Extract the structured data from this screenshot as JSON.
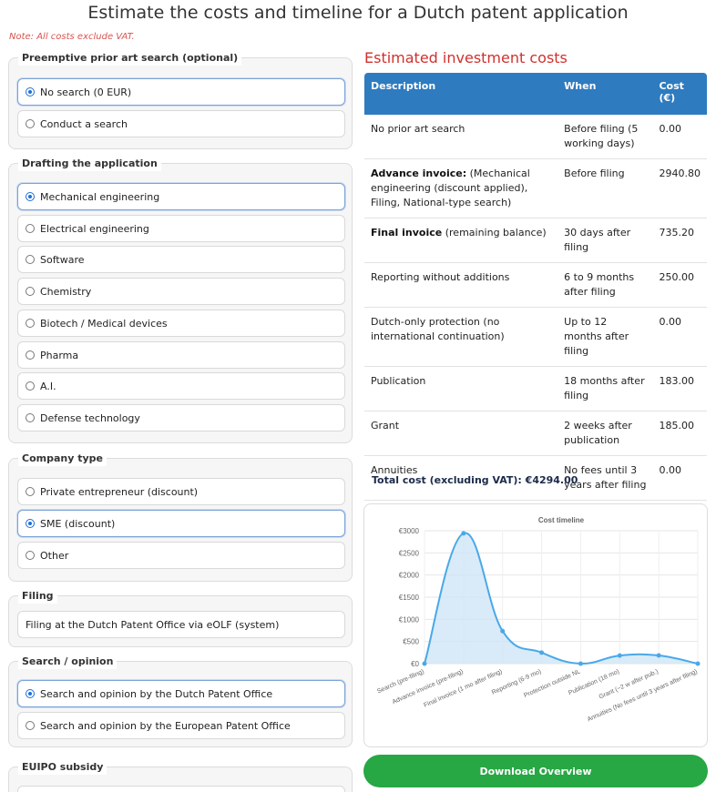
{
  "page": {
    "title": "Estimate the costs and timeline for a Dutch patent application",
    "note": "Note: All costs exclude VAT."
  },
  "prior_art": {
    "legend": "Preemptive prior art search (optional)",
    "options": [
      "No search (0 EUR)",
      "Conduct a search"
    ]
  },
  "drafting": {
    "legend": "Drafting the application",
    "options": [
      "Mechanical engineering",
      "Electrical engineering",
      "Software",
      "Chemistry",
      "Biotech / Medical devices",
      "Pharma",
      "A.I.",
      "Defense technology"
    ]
  },
  "company": {
    "legend": "Company type",
    "options": [
      "Private entrepreneur (discount)",
      "SME (discount)",
      "Other"
    ]
  },
  "filing": {
    "legend": "Filing",
    "value": "Filing at the Dutch Patent Office via eOLF (system)"
  },
  "search_opinion": {
    "legend": "Search / opinion",
    "options": [
      "Search and opinion by the Dutch Patent Office",
      "Search and opinion by the European Patent Office"
    ]
  },
  "euipo": {
    "legend": "EUIPO subsidy"
  },
  "costs": {
    "title": "Estimated investment costs",
    "headers": {
      "description": "Description",
      "when": "When",
      "cost": "Cost (€)"
    },
    "rows": [
      {
        "bold": "",
        "desc": "No prior art search",
        "when": "Before filing (5 working days)",
        "cost": "0.00"
      },
      {
        "bold": "Advance invoice:",
        "desc": " (Mechanical engineering (discount applied), Filing, National-type search)",
        "when": "Before filing",
        "cost": "2940.80"
      },
      {
        "bold": "Final invoice",
        "desc": " (remaining balance)",
        "when": "30 days after filing",
        "cost": "735.20"
      },
      {
        "bold": "",
        "desc": "Reporting without additions",
        "when": "6 to 9 months after filing",
        "cost": "250.00"
      },
      {
        "bold": "",
        "desc": "Dutch-only protection (no international continuation)",
        "when": "Up to 12 months after filing",
        "cost": "0.00"
      },
      {
        "bold": "",
        "desc": "Publication",
        "when": "18 months after filing",
        "cost": "183.00"
      },
      {
        "bold": "",
        "desc": "Grant",
        "when": "2 weeks after publication",
        "cost": "185.00"
      },
      {
        "bold": "",
        "desc": "Annuities",
        "when": "No fees until 3 years after filing",
        "cost": "0.00"
      }
    ],
    "total": "Total cost (excluding VAT): €4294.00"
  },
  "chart_data": {
    "type": "area",
    "title": "Cost timeline",
    "categories": [
      "Search (pre-filing)",
      "Advance invoice (pre-filing)",
      "Final invoice (1 mo after filing)",
      "Reporting (6-9 mo)",
      "Protection outside NL",
      "Publication (18 mo)",
      "Grant (~2 w after pub.)",
      "Annuities (No fees until 3 years after filing)"
    ],
    "values": [
      0,
      2940.8,
      735.2,
      250,
      0,
      183,
      185,
      0
    ],
    "ylim": [
      0,
      3000
    ],
    "yticks": [
      "€0",
      "€500",
      "€1000",
      "€1500",
      "€2000",
      "€2500",
      "€3000"
    ],
    "grid": true,
    "colors": {
      "line": "#4aa8e8",
      "fill": "#cfe6f8"
    }
  },
  "download": {
    "label": "Download Overview"
  }
}
